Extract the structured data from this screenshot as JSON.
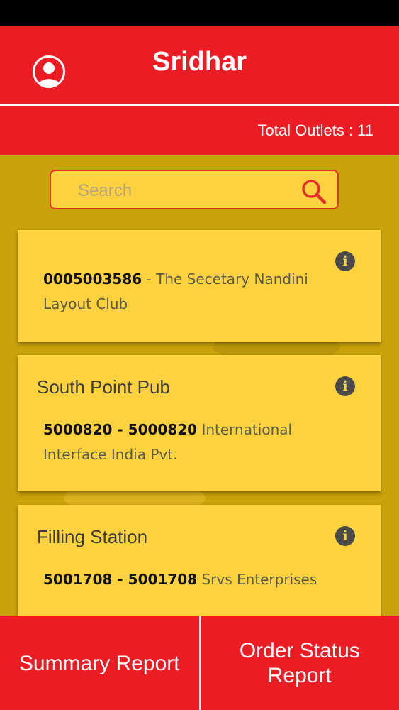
{
  "header": {
    "title": "Sridhar",
    "avatar_icon": "user-avatar-icon"
  },
  "subheader": {
    "total_outlets": "Total Outlets : 11"
  },
  "search": {
    "placeholder": "Search",
    "icon": "search-icon"
  },
  "outlets": [
    {
      "name": "",
      "code": "0005003586",
      "separator": " - ",
      "description": "The Secetary Nandini Layout Club",
      "info_icon": "info-icon"
    },
    {
      "name": "South Point Pub",
      "code": "5000820",
      "separator": " - ",
      "code2": "5000820",
      "description": "International Interface India Pvt.",
      "info_icon": "info-icon"
    },
    {
      "name": "Filling Station",
      "code": "5001708",
      "separator": " - ",
      "code2": "5001708",
      "description": "Srvs Enterprises",
      "info_icon": "info-icon"
    }
  ],
  "footer": {
    "summary_report": "Summary Report",
    "order_status_report": "Order Status Report"
  },
  "colors": {
    "primary_red": "#ec1c24",
    "background_gold": "#c9a20a",
    "card_yellow": "#fed23f"
  }
}
